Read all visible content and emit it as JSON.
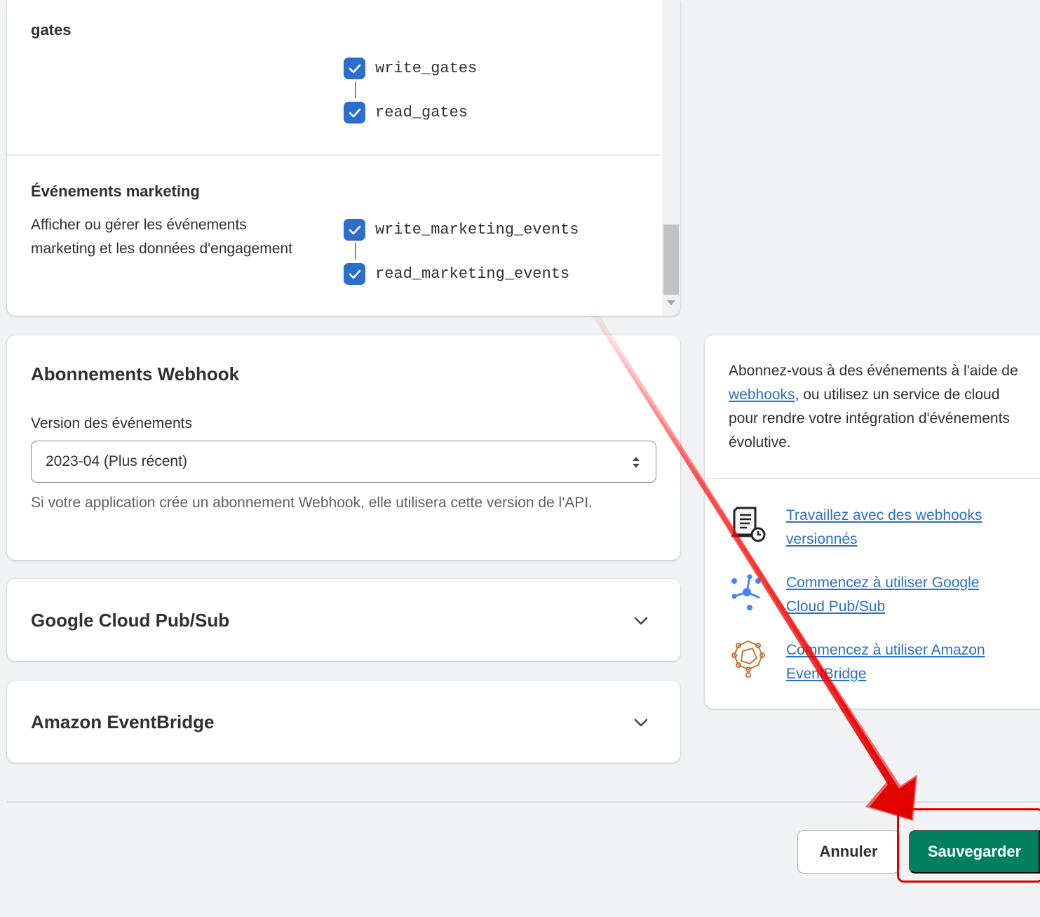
{
  "scopes": {
    "gates": {
      "title": "gates",
      "permissions": [
        {
          "label": "write_gates",
          "checked": true
        },
        {
          "label": "read_gates",
          "checked": true
        }
      ]
    },
    "marketing": {
      "title": "Événements marketing",
      "description": "Afficher ou gérer les événements marketing et les données d'engagement",
      "permissions": [
        {
          "label": "write_marketing_events",
          "checked": true
        },
        {
          "label": "read_marketing_events",
          "checked": true
        }
      ]
    }
  },
  "webhook": {
    "title": "Abonnements Webhook",
    "version_label": "Version des événements",
    "version_value": "2023-04 (Plus récent)",
    "help_text": "Si votre application crée un abonnement Webhook, elle utilisera cette version de l'API."
  },
  "google_pubsub": {
    "title": "Google Cloud Pub/Sub"
  },
  "eventbridge": {
    "title": "Amazon EventBridge"
  },
  "sidebar": {
    "intro_before": "Abonnez-vous à des événements à l'aide de ",
    "intro_link": "webhooks",
    "intro_after": ", ou utilisez un service de cloud pour rendre votre intégration d'événements évolutive.",
    "resources": [
      {
        "icon": "document-clock-icon",
        "label": "Travaillez avec des webhooks versionnés"
      },
      {
        "icon": "pubsub-icon",
        "label": "Commencez à utiliser Google Cloud Pub/Sub"
      },
      {
        "icon": "eventbridge-icon",
        "label": "Commencez à utiliser Amazon EventBridge"
      }
    ]
  },
  "footer": {
    "cancel_label": "Annuler",
    "save_label": "Sauvegarder"
  },
  "colors": {
    "primary": "#008060",
    "checkbox": "#2c6ecb",
    "link": "#2c6ecb",
    "annotation": "#e00000"
  }
}
